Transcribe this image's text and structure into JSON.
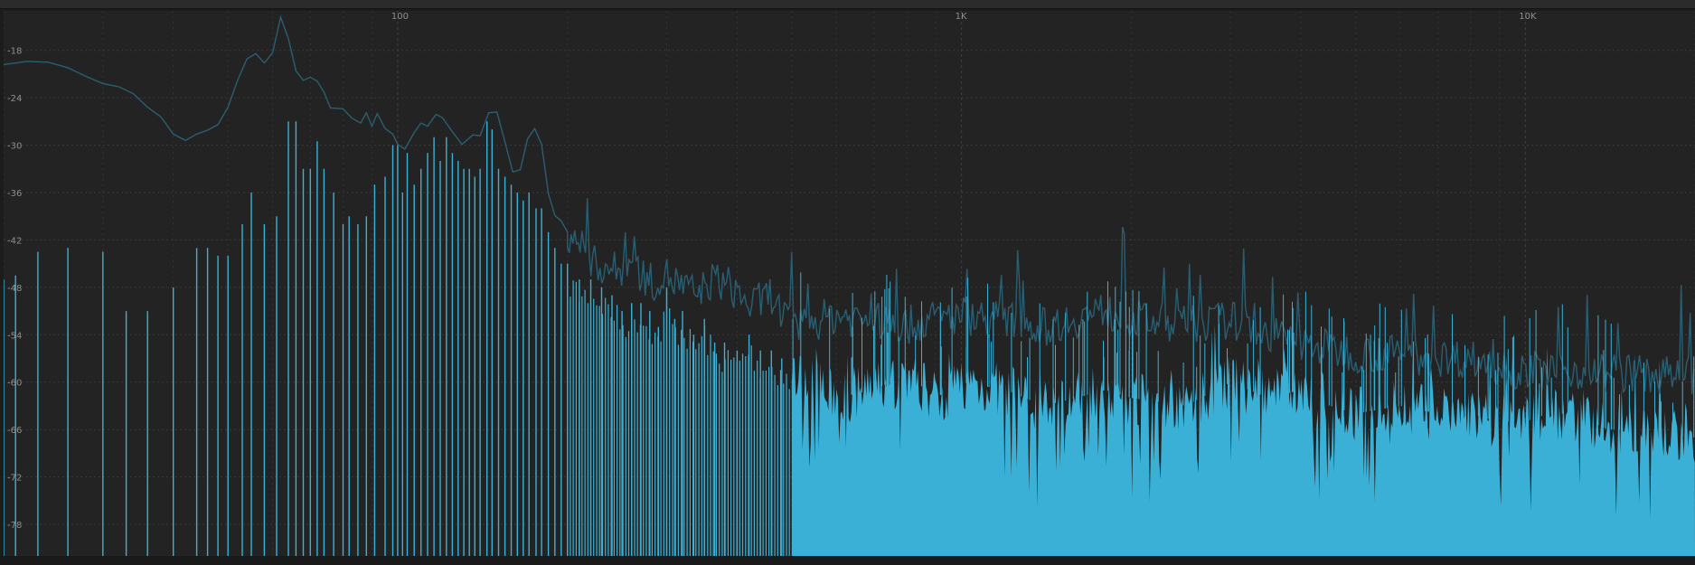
{
  "chart_data": {
    "type": "area",
    "title": "",
    "xlabel": "",
    "ylabel": "",
    "x_scale": "log",
    "xlim": [
      20,
      20000
    ],
    "ylim": [
      -82,
      -13
    ],
    "grid": true,
    "legend": "none",
    "x_ticks": [
      {
        "value": 100,
        "label": "100"
      },
      {
        "value": 1000,
        "label": "1K"
      },
      {
        "value": 10000,
        "label": "10K"
      }
    ],
    "y_ticks": [
      {
        "value": -18,
        "label": "-18"
      },
      {
        "value": -24,
        "label": "-24"
      },
      {
        "value": -30,
        "label": "-30"
      },
      {
        "value": -36,
        "label": "-36"
      },
      {
        "value": -42,
        "label": "-42"
      },
      {
        "value": -48,
        "label": "-48"
      },
      {
        "value": -54,
        "label": "-54"
      },
      {
        "value": -60,
        "label": "-60"
      },
      {
        "value": -66,
        "label": "-66"
      },
      {
        "value": -72,
        "label": "-72"
      },
      {
        "value": -78,
        "label": "-78"
      }
    ],
    "series": [
      {
        "kind": "spectrum",
        "color": "#3ab0d6",
        "bins": [
          [
            20,
            -47
          ],
          [
            21,
            -46.5
          ],
          [
            23,
            -43.5
          ],
          [
            26,
            -43
          ],
          [
            30,
            -43.5
          ],
          [
            33,
            -51
          ],
          [
            36,
            -51
          ],
          [
            40,
            -48
          ],
          [
            44,
            -43
          ],
          [
            46,
            -43
          ],
          [
            48,
            -44
          ],
          [
            50,
            -44
          ],
          [
            53,
            -40
          ],
          [
            55,
            -36
          ],
          [
            58,
            -40
          ],
          [
            61,
            -39
          ],
          [
            64,
            -27
          ],
          [
            66,
            -27
          ],
          [
            68,
            -33
          ],
          [
            70,
            -33
          ],
          [
            72,
            -29.5
          ],
          [
            74,
            -33
          ],
          [
            77,
            -36
          ],
          [
            80,
            -40
          ],
          [
            82,
            -39
          ],
          [
            85,
            -40
          ],
          [
            88,
            -39
          ],
          [
            91,
            -35
          ],
          [
            95,
            -34
          ],
          [
            98,
            -30
          ],
          [
            100,
            -30
          ],
          [
            102,
            -36
          ],
          [
            104,
            -31
          ],
          [
            107,
            -35
          ],
          [
            110,
            -33
          ],
          [
            113,
            -31
          ],
          [
            116,
            -29
          ],
          [
            119,
            -32
          ],
          [
            122,
            -29
          ],
          [
            125,
            -31
          ],
          [
            128,
            -32
          ],
          [
            131,
            -33
          ],
          [
            134,
            -33
          ],
          [
            137,
            -34
          ],
          [
            140,
            -33
          ],
          [
            144,
            -27
          ],
          [
            147,
            -28
          ],
          [
            151,
            -33
          ],
          [
            155,
            -34
          ],
          [
            159,
            -35
          ],
          [
            163,
            -36
          ],
          [
            167,
            -37
          ],
          [
            171,
            -36
          ],
          [
            176,
            -38
          ],
          [
            180,
            -38
          ],
          [
            185,
            -41
          ],
          [
            190,
            -43
          ],
          [
            195,
            -45
          ],
          [
            200,
            -45
          ],
          [
            210,
            -47
          ],
          [
            220,
            -47
          ],
          [
            230,
            -48
          ],
          [
            240,
            -49
          ],
          [
            250,
            -51
          ],
          [
            260,
            -50
          ],
          [
            270,
            -50
          ],
          [
            280,
            -51
          ],
          [
            290,
            -53
          ],
          [
            300,
            -48
          ],
          [
            310,
            -52
          ],
          [
            320,
            -51
          ],
          [
            335,
            -54
          ],
          [
            350,
            -52
          ],
          [
            365,
            -55
          ],
          [
            380,
            -55
          ],
          [
            400,
            -56
          ],
          [
            420,
            -54
          ],
          [
            440,
            -56
          ],
          [
            460,
            -56
          ],
          [
            480,
            -57
          ],
          [
            500,
            -59
          ],
          [
            600,
            -62
          ],
          [
            700,
            -61
          ],
          [
            800,
            -59
          ],
          [
            900,
            -62
          ],
          [
            1000,
            -60
          ],
          [
            1200,
            -61
          ],
          [
            1400,
            -63
          ],
          [
            1600,
            -62
          ],
          [
            1800,
            -61
          ],
          [
            2000,
            -62
          ],
          [
            2500,
            -63
          ],
          [
            3000,
            -60
          ],
          [
            3500,
            -62
          ],
          [
            4000,
            -61
          ],
          [
            4500,
            -63
          ],
          [
            5000,
            -64
          ],
          [
            6000,
            -63
          ],
          [
            7000,
            -64
          ],
          [
            8000,
            -64
          ],
          [
            9000,
            -65
          ],
          [
            10000,
            -65
          ],
          [
            11000,
            -64
          ],
          [
            12000,
            -64
          ],
          [
            13000,
            -65
          ],
          [
            14000,
            -66
          ],
          [
            15000,
            -66
          ],
          [
            16000,
            -66
          ],
          [
            18000,
            -67
          ],
          [
            20000,
            -67
          ]
        ]
      },
      {
        "kind": "envelope",
        "color": "#2a5f72",
        "points": [
          [
            20,
            -19.8
          ],
          [
            21,
            -19.6
          ],
          [
            22,
            -19.4
          ],
          [
            24,
            -19.5
          ],
          [
            26,
            -20.2
          ],
          [
            28,
            -21.3
          ],
          [
            30,
            -22.2
          ],
          [
            32,
            -22.6
          ],
          [
            34,
            -23.5
          ],
          [
            36,
            -25.2
          ],
          [
            38,
            -26.4
          ],
          [
            40,
            -28.6
          ],
          [
            42,
            -29.4
          ],
          [
            44,
            -28.6
          ],
          [
            46,
            -28.1
          ],
          [
            48,
            -27.4
          ],
          [
            50,
            -25.2
          ],
          [
            52,
            -21.8
          ],
          [
            54,
            -19.1
          ],
          [
            56,
            -18.4
          ],
          [
            58,
            -19.6
          ],
          [
            60,
            -18.3
          ],
          [
            62,
            -13.8
          ],
          [
            64,
            -16.5
          ],
          [
            66,
            -20.6
          ],
          [
            68,
            -21.8
          ],
          [
            70,
            -21.4
          ],
          [
            72,
            -21.9
          ],
          [
            74,
            -23.3
          ],
          [
            76,
            -25.3
          ],
          [
            80,
            -25.4
          ],
          [
            83,
            -26.6
          ],
          [
            86,
            -27.2
          ],
          [
            88,
            -25.9
          ],
          [
            90,
            -27.6
          ],
          [
            92,
            -26.0
          ],
          [
            95,
            -27.9
          ],
          [
            98,
            -28.6
          ],
          [
            100,
            -29.9
          ],
          [
            103,
            -30.5
          ],
          [
            107,
            -28.4
          ],
          [
            110,
            -27.2
          ],
          [
            113,
            -27.6
          ],
          [
            117,
            -26.1
          ],
          [
            120,
            -26.5
          ],
          [
            125,
            -28.3
          ],
          [
            130,
            -29.9
          ],
          [
            136,
            -28.7
          ],
          [
            140,
            -28.8
          ],
          [
            145,
            -25.9
          ],
          [
            150,
            -25.8
          ],
          [
            155,
            -29.6
          ],
          [
            160,
            -33.4
          ],
          [
            165,
            -33.1
          ],
          [
            170,
            -29.2
          ],
          [
            175,
            -27.9
          ],
          [
            180,
            -29.9
          ],
          [
            185,
            -36.1
          ],
          [
            190,
            -38.9
          ],
          [
            195,
            -39.6
          ],
          [
            200,
            -41.0
          ],
          [
            210,
            -42.0
          ],
          [
            220,
            -45.0
          ],
          [
            230,
            -45.2
          ],
          [
            245,
            -46.0
          ],
          [
            260,
            -45.0
          ],
          [
            280,
            -47.4
          ],
          [
            300,
            -46.5
          ],
          [
            320,
            -48.0
          ],
          [
            340,
            -49.0
          ],
          [
            360,
            -47.1
          ],
          [
            380,
            -47.4
          ],
          [
            400,
            -48.6
          ],
          [
            420,
            -50.3
          ],
          [
            440,
            -49.8
          ],
          [
            460,
            -48.8
          ],
          [
            480,
            -51.5
          ],
          [
            500,
            -53.1
          ],
          [
            600,
            -51.5
          ],
          [
            700,
            -52.3
          ],
          [
            800,
            -52.8
          ],
          [
            900,
            -52.0
          ],
          [
            1000,
            -51.5
          ],
          [
            1200,
            -52.1
          ],
          [
            1400,
            -53.0
          ],
          [
            1600,
            -51.9
          ],
          [
            1800,
            -51.0
          ],
          [
            2000,
            -52.0
          ],
          [
            2500,
            -52.7
          ],
          [
            3000,
            -52.1
          ],
          [
            3500,
            -53.9
          ],
          [
            4000,
            -55.0
          ],
          [
            4500,
            -55.8
          ],
          [
            5000,
            -56.3
          ],
          [
            6000,
            -56.5
          ],
          [
            7000,
            -56.9
          ],
          [
            8000,
            -57.0
          ],
          [
            9000,
            -58.0
          ],
          [
            10000,
            -58.6
          ],
          [
            12000,
            -58.5
          ],
          [
            14000,
            -58.6
          ],
          [
            16000,
            -59.0
          ],
          [
            18000,
            -59.2
          ],
          [
            20000,
            -59.1
          ]
        ]
      }
    ]
  }
}
